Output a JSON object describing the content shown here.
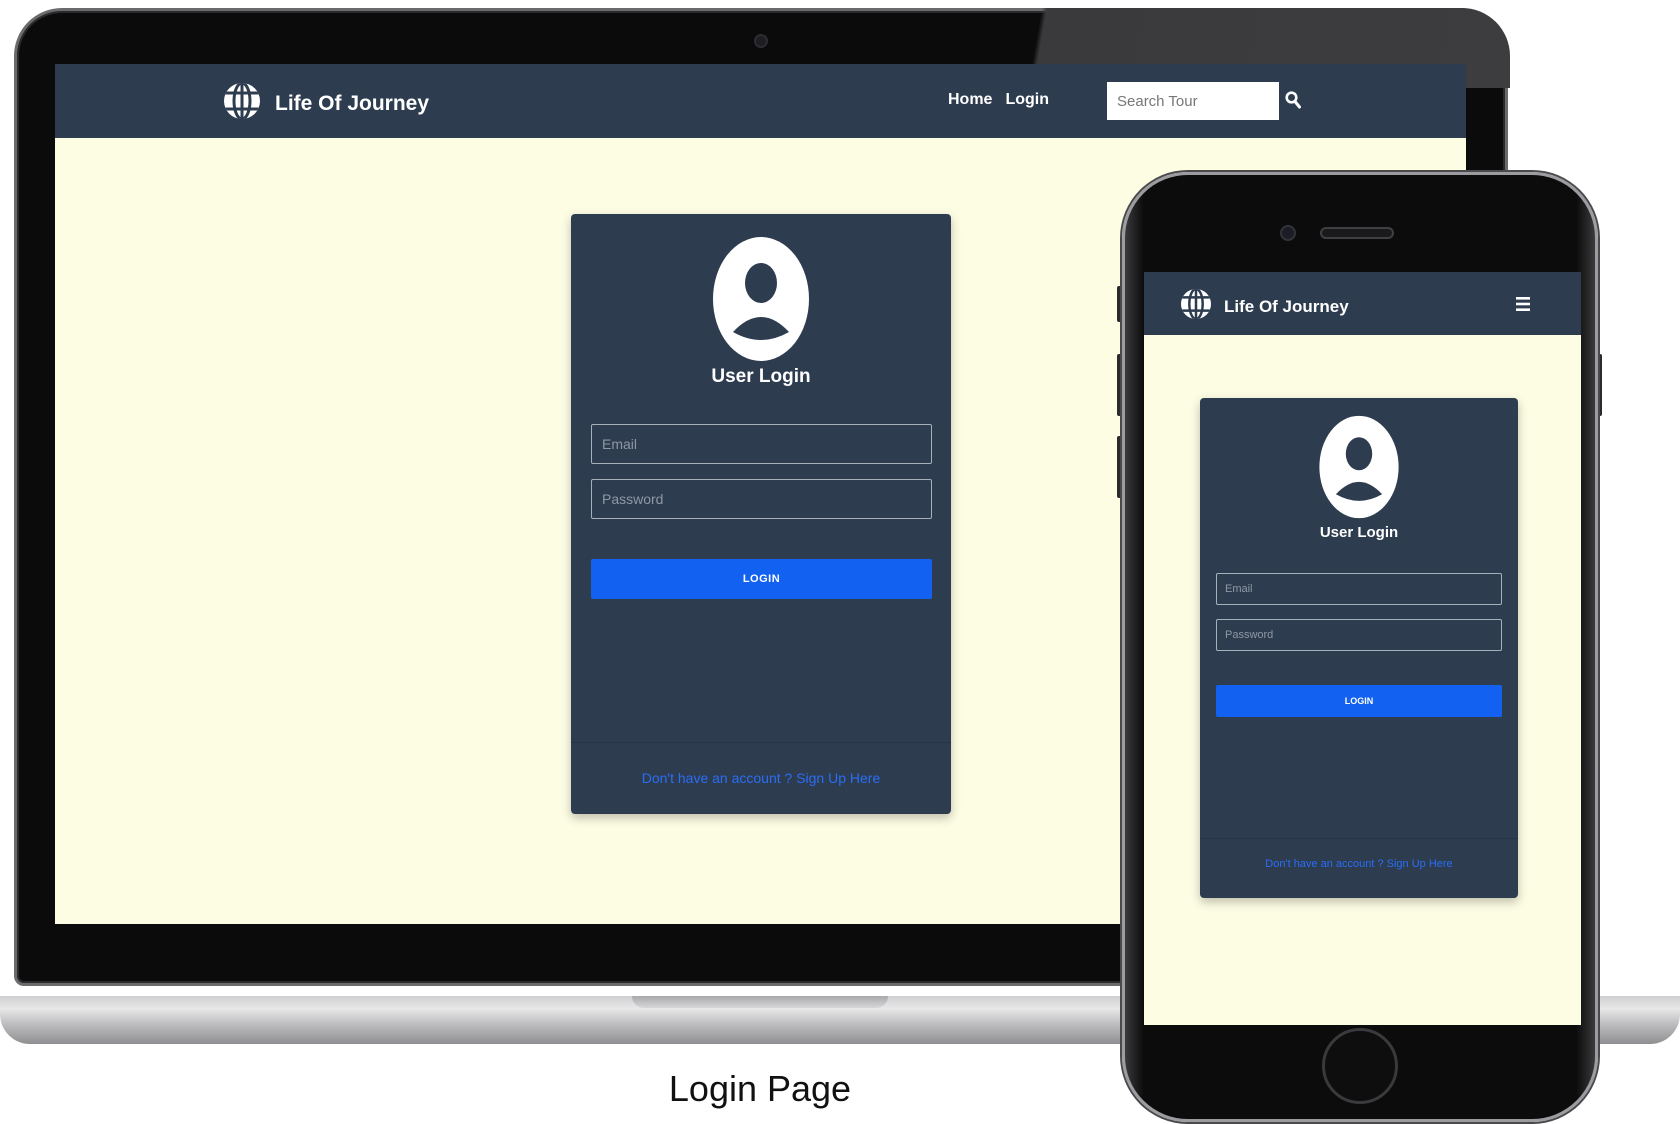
{
  "caption": "Login Page",
  "colors": {
    "nav_background": "#2e3c4f",
    "page_background": "#fdfde4",
    "accent_button": "#1261f0",
    "link": "#2a6ef5",
    "text": "#ffffff"
  },
  "icons": {
    "brand": "globe-icon",
    "search": "search-icon",
    "avatar": "user-avatar-icon",
    "menu": "hamburger-menu-icon"
  },
  "desktop": {
    "brand": "Life Of Journey",
    "nav_links": [
      "Home",
      "Login"
    ],
    "search": {
      "placeholder": "Search Tour",
      "value": ""
    },
    "card": {
      "title": "User Login",
      "email_placeholder": "Email",
      "password_placeholder": "Password",
      "login_label": "LOGIN",
      "signup_text": "Don't have an account ? Sign Up Here"
    }
  },
  "mobile": {
    "brand": "Life Of Journey",
    "card": {
      "title": "User Login",
      "email_placeholder": "Email",
      "password_placeholder": "Password",
      "login_label": "LOGIN",
      "signup_text": "Don't have an account ? Sign Up Here"
    }
  }
}
